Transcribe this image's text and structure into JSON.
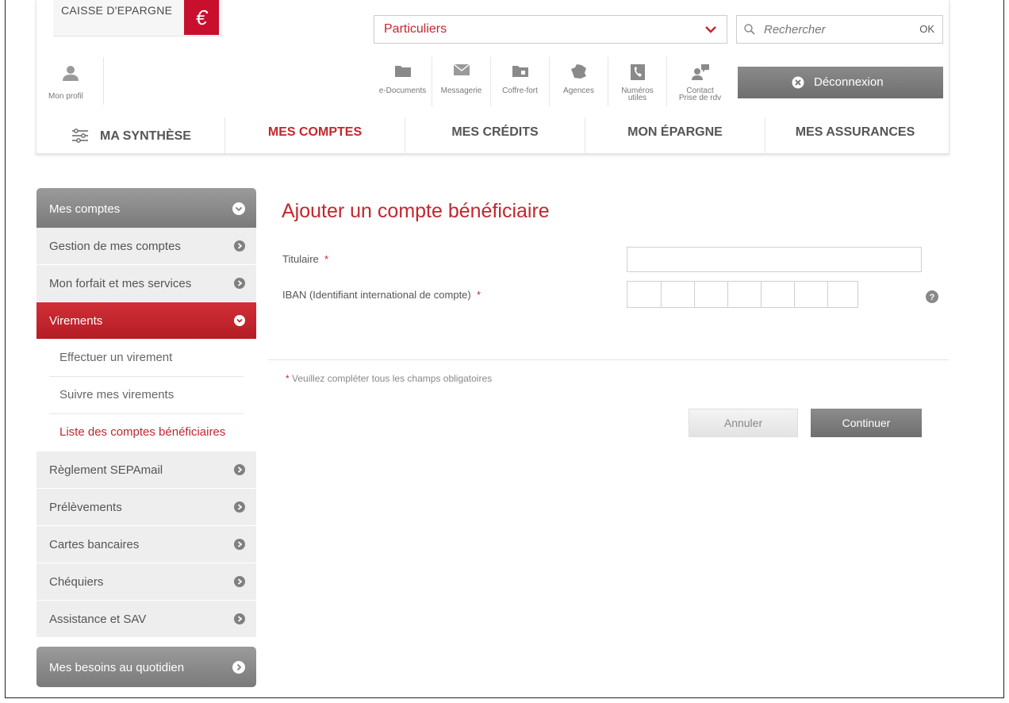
{
  "brand": {
    "name": "CAISSE D'EPARGNE",
    "accent_color": "#c4262e"
  },
  "header": {
    "segment": {
      "value": "Particuliers"
    },
    "search": {
      "placeholder": "Rechercher",
      "ok_label": "OK"
    },
    "profile": {
      "label": "Mon profil",
      "icon": "user-icon"
    },
    "tools": [
      {
        "label": "e-Documents",
        "icon": "folder-icon"
      },
      {
        "label": "Messagerie",
        "icon": "mail-icon"
      },
      {
        "label": "Coffre-fort",
        "icon": "safe-icon"
      },
      {
        "label": "Agences",
        "icon": "france-map-icon"
      },
      {
        "label": "Numéros\nutiles",
        "icon": "phone-icon"
      },
      {
        "label": "Contact\nPrise de rdv",
        "icon": "contact-icon"
      }
    ],
    "logout_label": "Déconnexion"
  },
  "nav": {
    "synthese": "MA SYNTHÈSE",
    "comptes": "MES COMPTES",
    "credits": "MES CRÉDITS",
    "epargne": "MON ÉPARGNE",
    "assurances": "MES ASSURANCES"
  },
  "sidebar": {
    "header": "Mes comptes",
    "items": {
      "gestion": "Gestion de mes comptes",
      "forfait": "Mon forfait et mes services",
      "virements": "Virements",
      "sepamail": "Règlement SEPAmail",
      "prelevements": "Prélèvements",
      "cartes": "Cartes bancaires",
      "chequiers": "Chéquiers",
      "assistance": "Assistance et SAV"
    },
    "subitems": {
      "effectuer": "Effectuer un virement",
      "suivre": "Suivre mes virements",
      "liste": "Liste des comptes bénéficiaires"
    },
    "footer": "Mes besoins au quotidien"
  },
  "form": {
    "title": "Ajouter un compte bénéficiaire",
    "titulaire_label": "Titulaire",
    "iban_label": "IBAN (Identifiant international de compte)",
    "required_marker": "*",
    "required_note": "Veuillez compléter tous les champs obligatoires",
    "cancel_label": "Annuler",
    "continue_label": "Continuer"
  }
}
